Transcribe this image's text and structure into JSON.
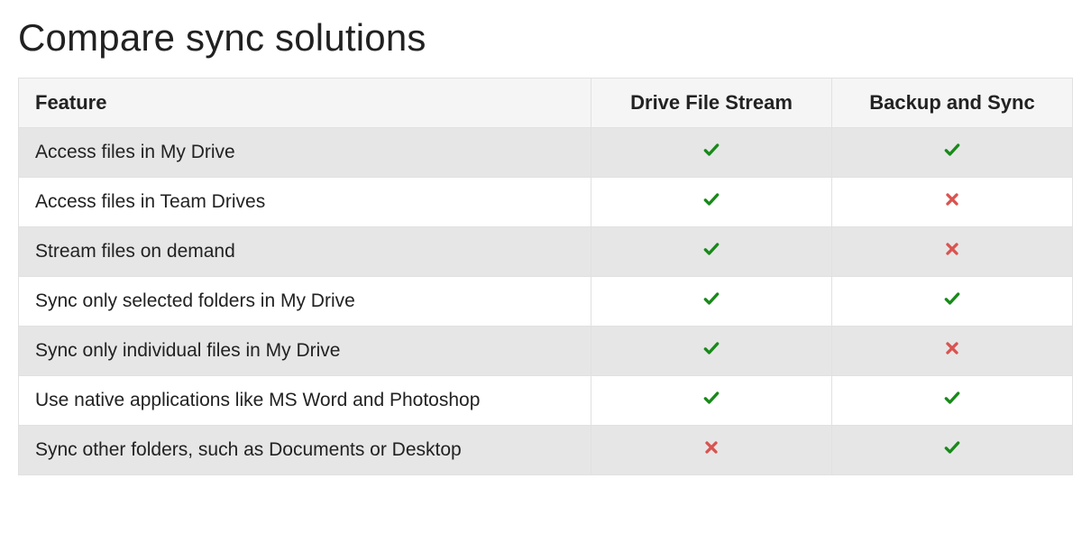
{
  "heading": "Compare sync solutions",
  "table": {
    "headers": {
      "feature": "Feature",
      "col1": "Drive File Stream",
      "col2": "Backup and Sync"
    },
    "rows": [
      {
        "feature": "Access files in My Drive",
        "col1": true,
        "col2": true
      },
      {
        "feature": "Access files in Team Drives",
        "col1": true,
        "col2": false
      },
      {
        "feature": "Stream files on demand",
        "col1": true,
        "col2": false
      },
      {
        "feature": "Sync only selected folders in My Drive",
        "col1": true,
        "col2": true
      },
      {
        "feature": "Sync only individual files in My Drive",
        "col1": true,
        "col2": false
      },
      {
        "feature": "Use native applications like MS Word and Photoshop",
        "col1": true,
        "col2": true
      },
      {
        "feature": "Sync other folders, such as Documents or Desktop",
        "col1": false,
        "col2": true
      }
    ]
  },
  "icons": {
    "check": "check-icon",
    "cross": "cross-icon"
  }
}
